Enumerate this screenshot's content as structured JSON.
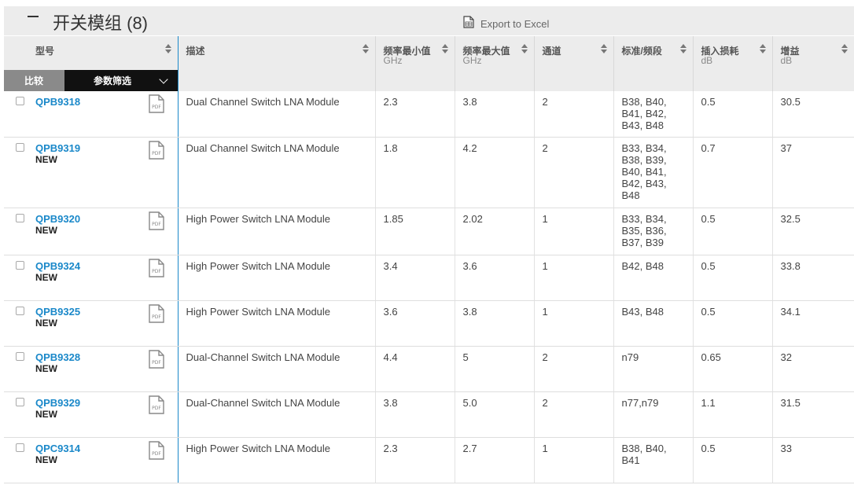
{
  "header": {
    "title": "开关模组 (8)",
    "export_label": "Export to Excel"
  },
  "toolbar": {
    "compare_label": "比较",
    "filter_label": "参数筛选"
  },
  "columns": [
    {
      "label": "型号",
      "unit": ""
    },
    {
      "label": "描述",
      "unit": ""
    },
    {
      "label": "频率最小值",
      "unit": "GHz"
    },
    {
      "label": "频率最大值",
      "unit": "GHz"
    },
    {
      "label": "通道",
      "unit": ""
    },
    {
      "label": "标准/频段",
      "unit": ""
    },
    {
      "label": "插入损耗",
      "unit": "dB"
    },
    {
      "label": "增益",
      "unit": "dB"
    }
  ],
  "rows": [
    {
      "part": "QPB9318",
      "tag": "",
      "desc": "Dual Channel Switch LNA Module",
      "fmin": "2.3",
      "fmax": "3.8",
      "ch": "2",
      "bands": [
        "B38, B40,",
        "B41, B42,",
        "B43, B48"
      ],
      "loss": "0.5",
      "gain": "30.5"
    },
    {
      "part": "QPB9319",
      "tag": "NEW",
      "desc": "Dual Channel Switch LNA Module",
      "fmin": "1.8",
      "fmax": "4.2",
      "ch": "2",
      "bands": [
        "B33, B34,",
        "B38, B39,",
        "B40, B41,",
        "B42, B43,",
        "B48"
      ],
      "loss": "0.7",
      "gain": "37"
    },
    {
      "part": "QPB9320",
      "tag": "NEW",
      "desc": "High Power Switch LNA Module",
      "fmin": "1.85",
      "fmax": "2.02",
      "ch": "1",
      "bands": [
        "B33, B34,",
        "B35, B36,",
        "B37, B39"
      ],
      "loss": "0.5",
      "gain": "32.5"
    },
    {
      "part": "QPB9324",
      "tag": "NEW",
      "desc": "High Power Switch LNA Module",
      "fmin": "3.4",
      "fmax": "3.6",
      "ch": "1",
      "bands": [
        "B42, B48"
      ],
      "loss": "0.5",
      "gain": "33.8"
    },
    {
      "part": "QPB9325",
      "tag": "NEW",
      "desc": "High Power Switch LNA Module",
      "fmin": "3.6",
      "fmax": "3.8",
      "ch": "1",
      "bands": [
        "B43, B48"
      ],
      "loss": "0.5",
      "gain": "34.1"
    },
    {
      "part": "QPB9328",
      "tag": "NEW",
      "desc": "Dual-Channel Switch LNA Module",
      "fmin": "4.4",
      "fmax": "5",
      "ch": "2",
      "bands": [
        "n79"
      ],
      "loss": "0.65",
      "gain": "32"
    },
    {
      "part": "QPB9329",
      "tag": "NEW",
      "desc": "Dual-Channel Switch LNA Module",
      "fmin": "3.8",
      "fmax": "5.0",
      "ch": "2",
      "bands": [
        "n77,n79"
      ],
      "loss": "1.1",
      "gain": "31.5"
    },
    {
      "part": "QPC9314",
      "tag": "NEW",
      "desc": "High Power Switch LNA Module",
      "fmin": "2.3",
      "fmax": "2.7",
      "ch": "1",
      "bands": [
        "B38, B40,",
        "B41"
      ],
      "loss": "0.5",
      "gain": "33"
    }
  ],
  "icons": {
    "collapse": "minus-icon",
    "export": "excel-file-icon",
    "datasheet": "pdf-icon",
    "sort": "sort-icon",
    "filter": "chevron-down-icon"
  },
  "colors": {
    "link": "#1a88c9",
    "header_bg": "#ececec",
    "compare_bg": "#8a8a8a",
    "filter_bg": "#111111"
  }
}
